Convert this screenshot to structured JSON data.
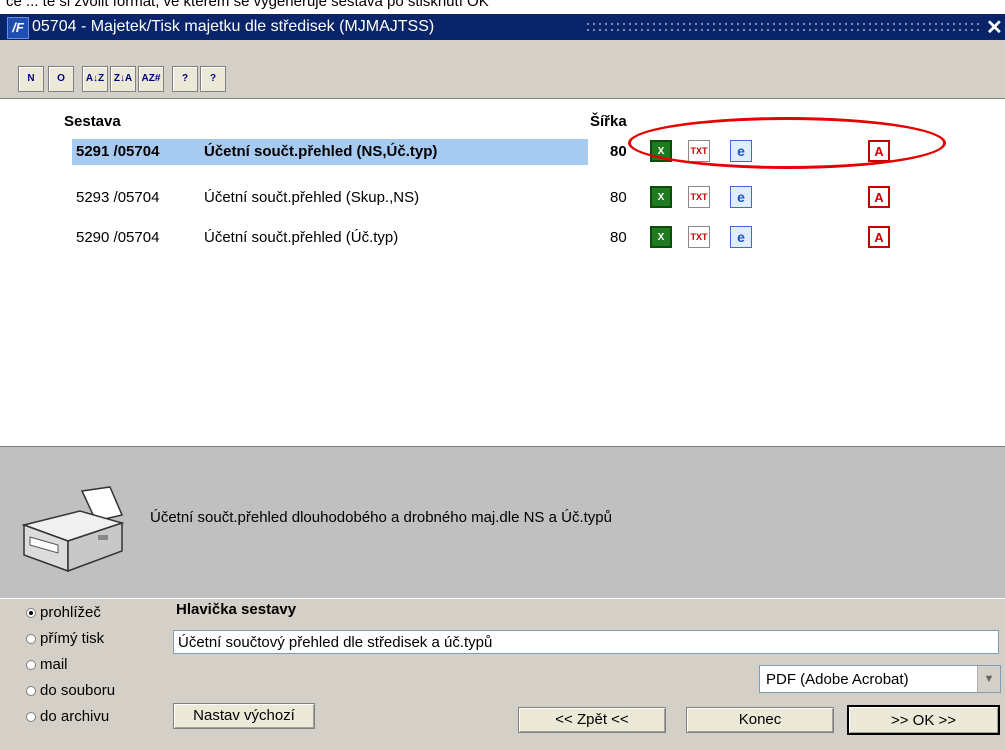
{
  "top_strip_text": "ce ... te si zvolit formát, ve kterém se vygeneruje sestava po stisknutí OK",
  "window": {
    "title": "05704 - Majetek/Tisk  majetku dle středisek (MJMAJTSS)",
    "close_glyph": "✕"
  },
  "toolbar": {
    "buttons": [
      {
        "name": "new-report-button",
        "glyph": "N"
      },
      {
        "name": "open-report-button",
        "glyph": "O"
      },
      {
        "name": "sort-asc-button",
        "glyph": "A↓Z"
      },
      {
        "name": "sort-desc-button",
        "glyph": "Z↓A"
      },
      {
        "name": "sort-custom-button",
        "glyph": "AZ#"
      },
      {
        "name": "help-button",
        "glyph": "?"
      },
      {
        "name": "context-help-button",
        "glyph": "?"
      }
    ]
  },
  "list": {
    "col_report": "Sestava",
    "col_width": "Šířka",
    "rows": [
      {
        "num": "5291 /05704",
        "name": "Účetní součt.přehled (NS,Úč.typ)",
        "width": "80",
        "selected": true
      },
      {
        "num": "5293 /05704",
        "name": "Účetní součt.přehled (Skup.,NS)",
        "width": "80",
        "selected": false
      },
      {
        "num": "5290 /05704",
        "name": "Účetní součt.přehled (Úč.typ)",
        "width": "80",
        "selected": false
      }
    ],
    "icons": {
      "xls": "X",
      "txt": "TXT",
      "ie": "e",
      "pdf": "A"
    }
  },
  "description": "Účetní součt.přehled dlouhodobého a drobného maj.dle NS a Úč.typů",
  "output": {
    "options": [
      {
        "label": "prohlížeč",
        "checked": true
      },
      {
        "label": "přímý tisk",
        "checked": false
      },
      {
        "label": "mail",
        "checked": false
      },
      {
        "label": "do souboru",
        "checked": false
      },
      {
        "label": "do archivu",
        "checked": false
      }
    ]
  },
  "header": {
    "label": "Hlavička sestavy",
    "value": "Účetní součtový přehled dle středisek a úč.typů"
  },
  "format": {
    "selected": "PDF (Adobe Acrobat)",
    "arrow": "▼"
  },
  "buttons": {
    "defaults": "Nastav výchozí",
    "back": "<< Zpět <<",
    "end": "Konec",
    "ok": ">> OK >>"
  },
  "colors": {
    "titlebar": "#0a246a",
    "selection": "#a6caf0",
    "highlight_ellipse": "#e60000"
  }
}
